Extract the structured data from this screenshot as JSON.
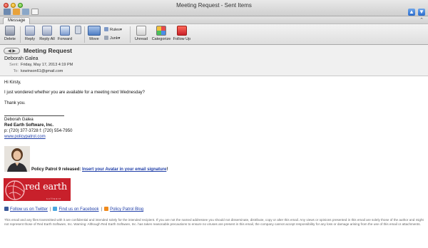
{
  "window": {
    "title": "Meeting Request - Sent Items"
  },
  "tabs": {
    "message": "Message"
  },
  "ribbon": {
    "delete": "Delete",
    "reply": "Reply",
    "reply_all": "Reply All",
    "forward": "Forward",
    "move": "Move",
    "rules": "Rules",
    "junk": "Junk",
    "unread": "Unread",
    "categorize": "Categorize",
    "follow_up": "Follow Up"
  },
  "header": {
    "subject": "Meeting Request",
    "from": "Deborah Galea",
    "sent_label": "Sent:",
    "sent_value": "Friday, May 17, 2013 4:19 PM",
    "to_label": "To:",
    "to_value": "kswinson61@gmail.com"
  },
  "body": {
    "greeting": "Hi Kirsty,",
    "message": "I just wondered whether you are available for a meeting next Wednesday?",
    "closing": "Thank you."
  },
  "signature": {
    "name": "Deborah Galea",
    "company": "Red Earth Software, Inc.",
    "phone": "p: (720) 377-3728 f: (720) 554-7950",
    "website": "www.policypatrol.com",
    "promo_prefix": "Policy Patrol 9 released: ",
    "promo_link": "Insert your Avatar in your email signature",
    "promo_suffix": "!",
    "logo_text": "red earth",
    "logo_sub": "software",
    "twitter": "Follow us on Twitter",
    "facebook": "Find us on Facebook",
    "blog": "Policy Patrol Blog",
    "separator": "|",
    "disclaimer": "This email and any files transmitted with it are confidential and intended solely for the intended recipient. If you are not the named addressee you should not disseminate, distribute, copy or alter this email. Any views or opinions presented in this email are solely those of the author and might not represent those of Red Earth Software, Inc. Warning: Although Red Earth Software, Inc. has taken reasonable precautions to ensure no viruses are present in this email, the company cannot accept responsibility for any loss or damage arising from the use of this email or attachments."
  },
  "icons": {
    "nav_up": "arrow-up-icon",
    "nav_down": "arrow-down-icon",
    "twitter": "twitter-icon",
    "facebook": "facebook-icon",
    "blog": "rss-icon"
  },
  "colors": {
    "link": "#1f3ea8",
    "logo_red": "#c8202b",
    "nav_blue": "#2a6ccc"
  }
}
